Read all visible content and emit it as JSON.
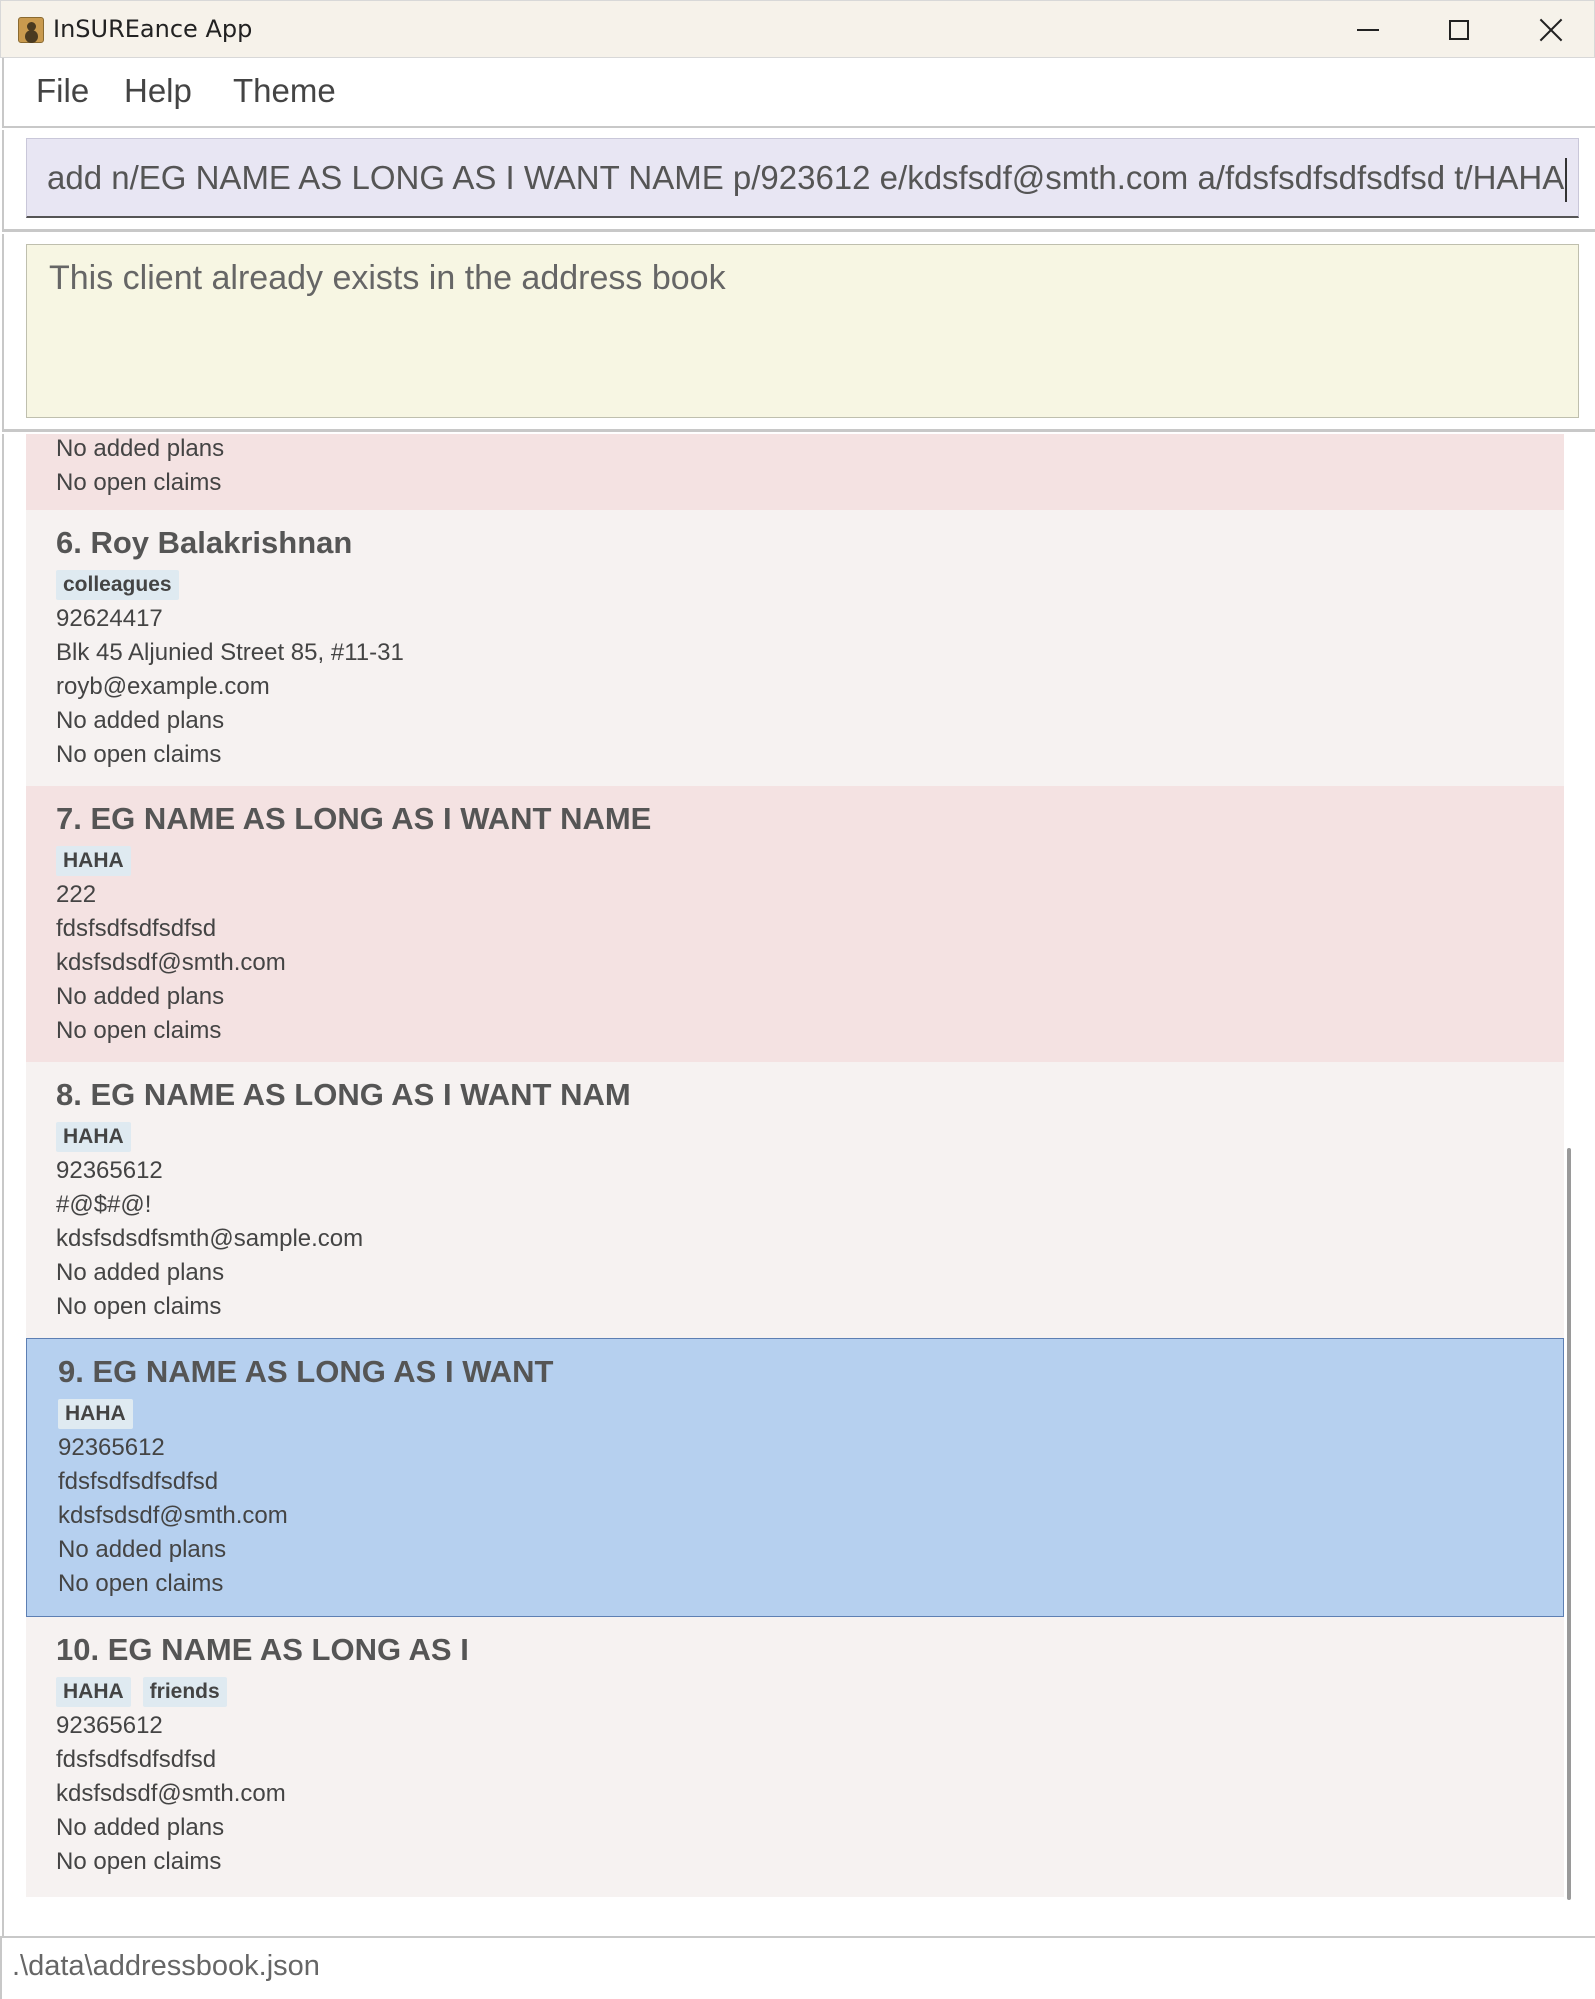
{
  "window": {
    "title": "InSUREance App"
  },
  "menu": {
    "file": "File",
    "help": "Help",
    "theme": "Theme"
  },
  "command": {
    "value": "add n/EG NAME AS LONG AS I WANT NAME p/923612 e/kdsfsdf@smth.com a/fdsfsdfsdfsdfsd t/HAHA"
  },
  "result": {
    "message": "This client already exists in the address book"
  },
  "clients": [
    {
      "plans": "No added plans",
      "claims": "No open claims"
    },
    {
      "name": "6. Roy Balakrishnan",
      "tags": [
        "colleagues"
      ],
      "phone": "92624417",
      "address": "Blk 45 Aljunied Street 85, #11-31",
      "email": "royb@example.com",
      "plans": "No added plans",
      "claims": "No open claims"
    },
    {
      "name": "7. EG NAME AS LONG AS I WANT NAME",
      "tags": [
        "HAHA"
      ],
      "phone": "222",
      "address": "fdsfsdfsdfsdfsd",
      "email": "kdsfsdsdf@smth.com",
      "plans": "No added plans",
      "claims": "No open claims"
    },
    {
      "name": "8. EG NAME AS LONG AS I WANT NAM",
      "tags": [
        "HAHA"
      ],
      "phone": "92365612",
      "address": "#@$#@!",
      "email": "kdsfsdsdfsmth@sample.com",
      "plans": "No added plans",
      "claims": "No open claims"
    },
    {
      "name": "9. EG NAME AS LONG AS I WANT",
      "tags": [
        "HAHA"
      ],
      "phone": "92365612",
      "address": "fdsfsdfsdfsdfsd",
      "email": "kdsfsdsdf@smth.com",
      "plans": "No added plans",
      "claims": "No open claims",
      "selected": true
    },
    {
      "name": "10. EG NAME AS LONG AS I",
      "tags": [
        "HAHA",
        "friends"
      ],
      "phone": "92365612",
      "address": "fdsfsdfsdfsdfsd",
      "email": "kdsfsdsdf@smth.com",
      "plans": "No added plans",
      "claims": "No open claims"
    }
  ],
  "status": {
    "path": ".\\data\\addressbook.json"
  },
  "colors": {
    "selected": "#b6d0ef",
    "odd_row": "#f4e2e2",
    "even_row": "#f6f2f1",
    "command_bg": "#e8e6f3",
    "result_bg": "#f7f6e3"
  }
}
